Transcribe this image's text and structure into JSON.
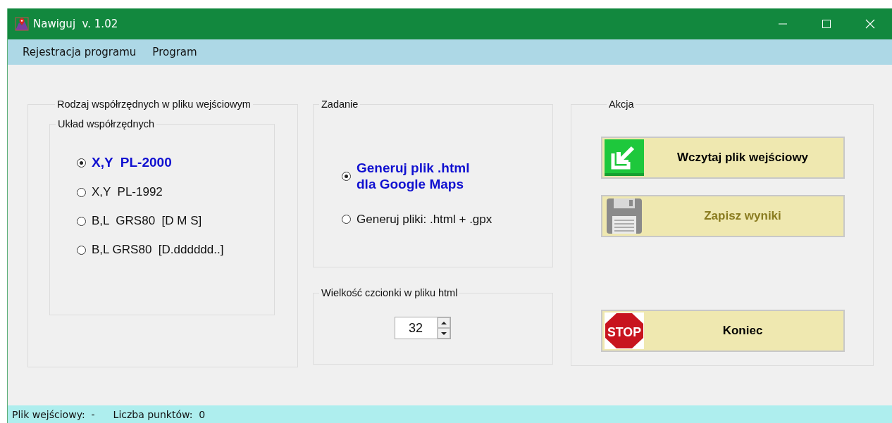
{
  "window": {
    "title": "Nawiguj  v. 1.02"
  },
  "menu": [
    "Rejestracja programu",
    "Program"
  ],
  "coordinates_group": {
    "title": "Rodzaj współrzędnych w pliku wejściowym",
    "inner_title": "Układ współrzędnych",
    "options": [
      {
        "label": "X,Y  PL-2000",
        "selected": true
      },
      {
        "label": "X,Y  PL-1992",
        "selected": false
      },
      {
        "label": "B,L  GRS80  [D M S]",
        "selected": false
      },
      {
        "label": "B,L GRS80  [D.dddddd..]",
        "selected": false
      }
    ]
  },
  "task_group": {
    "title": "Zadanie",
    "options": [
      {
        "label": "Generuj plik .html\ndla Google Maps",
        "selected": true
      },
      {
        "label": "Generuj pliki: .html + .gpx",
        "selected": false
      }
    ]
  },
  "font_size_group": {
    "title": "Wielkość czcionki w pliku html",
    "value": "32"
  },
  "action_group": {
    "title": "Akcja",
    "buttons": [
      {
        "kind": "import",
        "label": "Wczytaj plik wejściowy",
        "disabled": false
      },
      {
        "kind": "save",
        "label": "Zapisz wyniki",
        "disabled": true
      },
      {
        "kind": "stop",
        "label": "Koniec",
        "icon_label": "STOP",
        "disabled": false
      }
    ]
  },
  "status_bar": [
    "Plik wejściowy:  -",
    "Liczba punktów:  0"
  ]
}
